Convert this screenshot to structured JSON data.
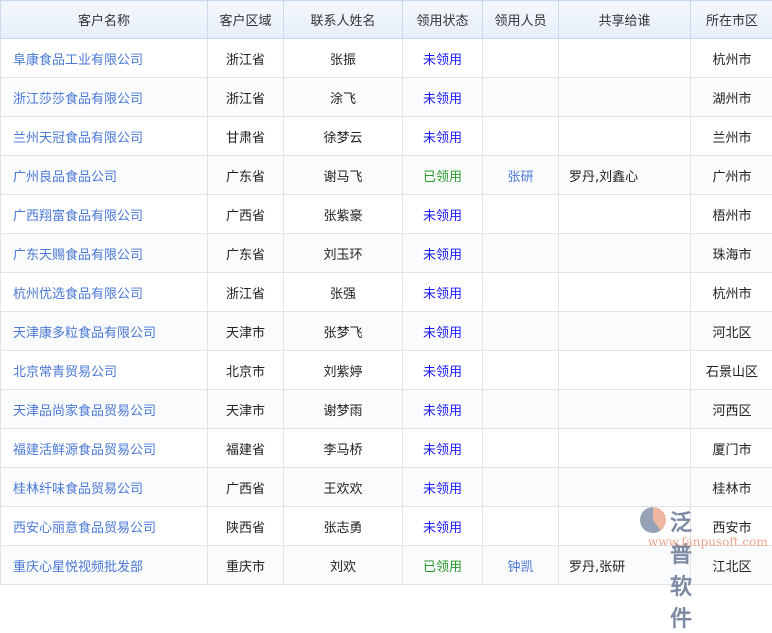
{
  "headers": [
    "客户名称",
    "客户区域",
    "联系人姓名",
    "领用状态",
    "领用人员",
    "共享给谁",
    "所在市区"
  ],
  "rows": [
    [
      "阜康食品工业有限公司",
      "浙江省",
      "张振",
      "未领用",
      "",
      "",
      "杭州市"
    ],
    [
      "浙江莎莎食品有限公司",
      "浙江省",
      "涂飞",
      "未领用",
      "",
      "",
      "湖州市"
    ],
    [
      "兰州天冠食品有限公司",
      "甘肃省",
      "徐梦云",
      "未领用",
      "",
      "",
      "兰州市"
    ],
    [
      "广州良品食品公司",
      "广东省",
      "谢马飞",
      "已领用",
      "张研",
      "罗丹,刘鑫心",
      "广州市"
    ],
    [
      "广西翔富食品有限公司",
      "广西省",
      "张紫豪",
      "未领用",
      "",
      "",
      "梧州市"
    ],
    [
      "广东天赐食品有限公司",
      "广东省",
      "刘玉环",
      "未领用",
      "",
      "",
      "珠海市"
    ],
    [
      "杭州优选食品有限公司",
      "浙江省",
      "张强",
      "未领用",
      "",
      "",
      "杭州市"
    ],
    [
      "天津康多粒食品有限公司",
      "天津市",
      "张梦飞",
      "未领用",
      "",
      "",
      "河北区"
    ],
    [
      "北京常青贸易公司",
      "北京市",
      "刘紫婷",
      "未领用",
      "",
      "",
      "石景山区"
    ],
    [
      "天津品尚家食品贸易公司",
      "天津市",
      "谢梦雨",
      "未领用",
      "",
      "",
      "河西区"
    ],
    [
      "福建活鲜源食品贸易公司",
      "福建省",
      "李马桥",
      "未领用",
      "",
      "",
      "厦门市"
    ],
    [
      "桂林纤味食品贸易公司",
      "广西省",
      "王欢欢",
      "未领用",
      "",
      "",
      "桂林市"
    ],
    [
      "西安心丽意食品贸易公司",
      "陕西省",
      "张志勇",
      "未领用",
      "",
      "",
      "西安市"
    ],
    [
      "重庆心星悦视频批发部",
      "重庆市",
      "刘欢",
      "已领用",
      "钟凯",
      "罗丹,张研",
      "江北区"
    ]
  ],
  "watermark": {
    "brand": "泛普软件",
    "url": "www.fanpusoft.com"
  },
  "colors": {
    "link": "#4a78d6",
    "unclaimed": "#1a1aff",
    "claimed": "#2a9a2a",
    "header_bg": "#e6eefa"
  }
}
